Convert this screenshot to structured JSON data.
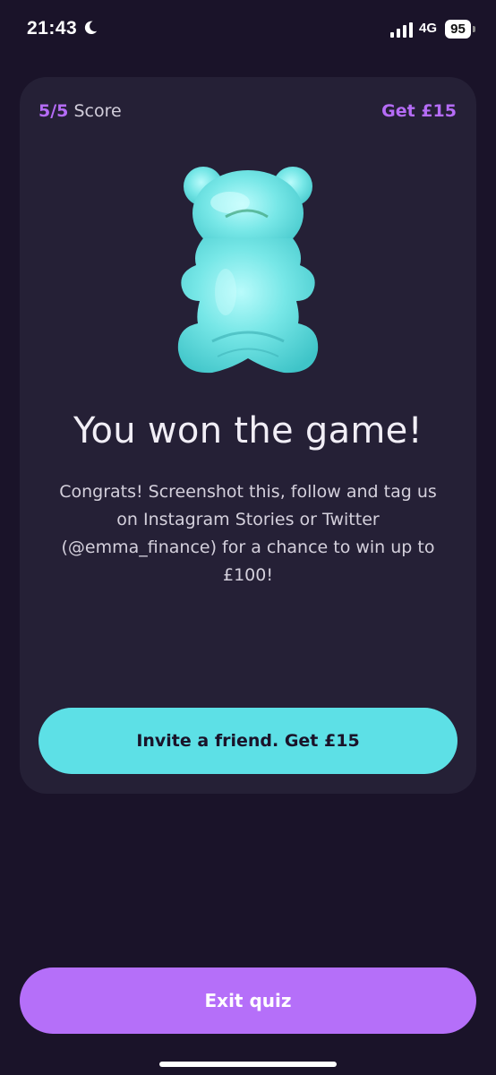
{
  "status_bar": {
    "time": "21:43",
    "network": "4G",
    "battery": "95"
  },
  "card": {
    "score_value": "5/5",
    "score_label": "Score",
    "reward_link": "Get £15",
    "headline": "You won the game!",
    "message": "Congrats! Screenshot this, follow and tag us on Instagram Stories or Twitter (@emma_finance) for a chance to win up to £100!",
    "invite_button": "Invite a friend. Get £15"
  },
  "exit_button": "Exit quiz",
  "colors": {
    "background": "#1a1329",
    "card": "#252036",
    "accent_purple": "#b56cf6",
    "accent_cyan": "#5de0e6"
  }
}
